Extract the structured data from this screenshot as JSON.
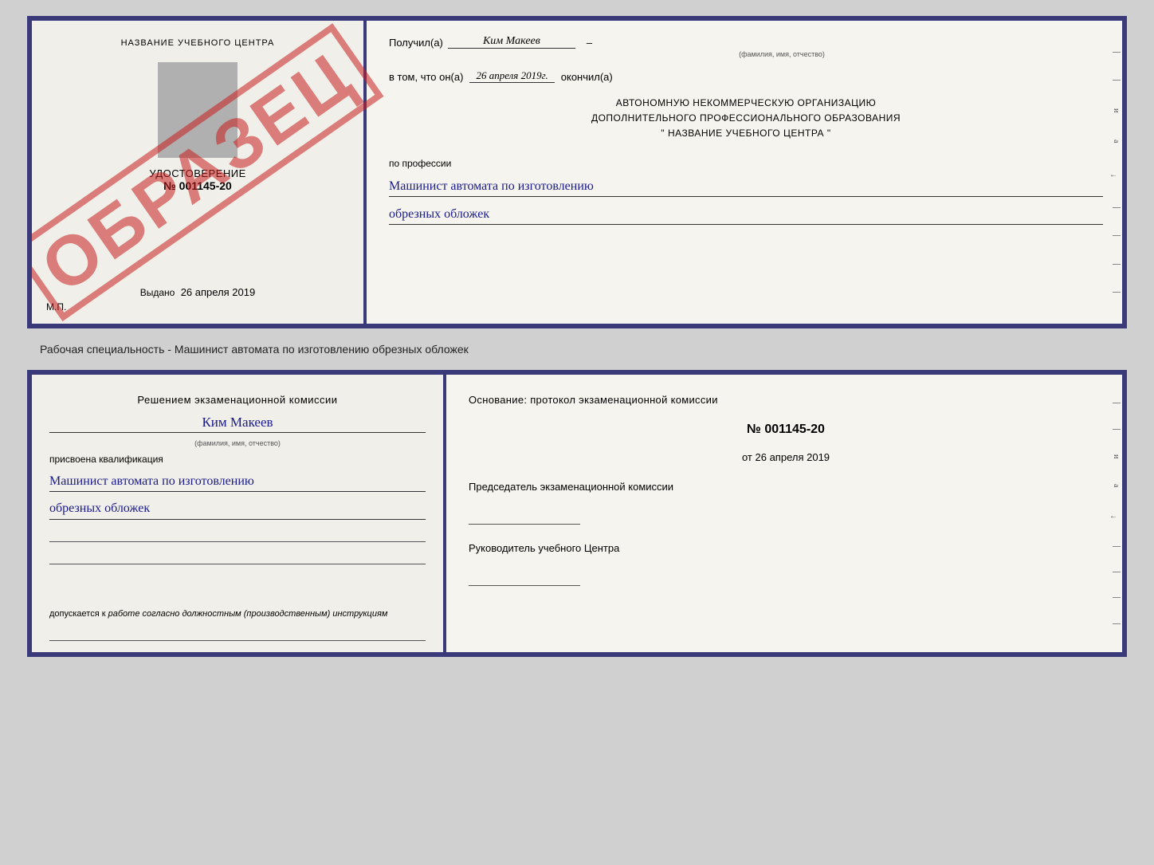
{
  "top_doc": {
    "left": {
      "school_name": "НАЗВАНИЕ УЧЕБНОГО ЦЕНТРА",
      "watermark": "ОБРАЗЕЦ",
      "udost_label": "УДОСТОВЕРЕНИЕ",
      "udost_number": "№ 001145-20",
      "vydano": "Выдано",
      "vydano_date": "26 апреля 2019",
      "mp": "М.П."
    },
    "right": {
      "poluchil_label": "Получил(а)",
      "recipient_name": "Ким Макеев",
      "fio_subtext": "(фамилия, имя, отчество)",
      "vtom_label": "в том, что он(а)",
      "vtom_date": "26 апреля 2019г.",
      "okonchil": "окончил(а)",
      "org_line1": "АВТОНОМНУЮ НЕКОММЕРЧЕСКУЮ ОРГАНИЗАЦИЮ",
      "org_line2": "ДОПОЛНИТЕЛЬНОГО ПРОФЕССИОНАЛЬНОГО ОБРАЗОВАНИЯ",
      "org_line3": "\"    НАЗВАНИЕ УЧЕБНОГО ЦЕНТРА    \"",
      "po_professii": "по профессии",
      "profession_line1": "Машинист автомата по изготовлению",
      "profession_line2": "обрезных обложек"
    }
  },
  "specialty_text": "Рабочая специальность - Машинист автомата по изготовлению обрезных обложек",
  "bottom_doc": {
    "left": {
      "header_line1": "Решением экзаменационной комиссии",
      "name": "Ким Макеев",
      "fio_subtext": "(фамилия, имя, отчество)",
      "prisvoena": "присвоена квалификация",
      "kvalif_line1": "Машинист автомата по изготовлению",
      "kvalif_line2": "обрезных обложек",
      "dopusk_prefix": "допускается к",
      "dopusk_text": "работе согласно должностным (производственным) инструкциям"
    },
    "right": {
      "osnovanie": "Основание: протокол экзаменационной комиссии",
      "number": "№  001145-20",
      "ot_label": "от",
      "date": "26 апреля 2019",
      "chairman_label": "Председатель экзаменационной комиссии",
      "rukovoditel_label": "Руководитель учебного Центра"
    }
  }
}
